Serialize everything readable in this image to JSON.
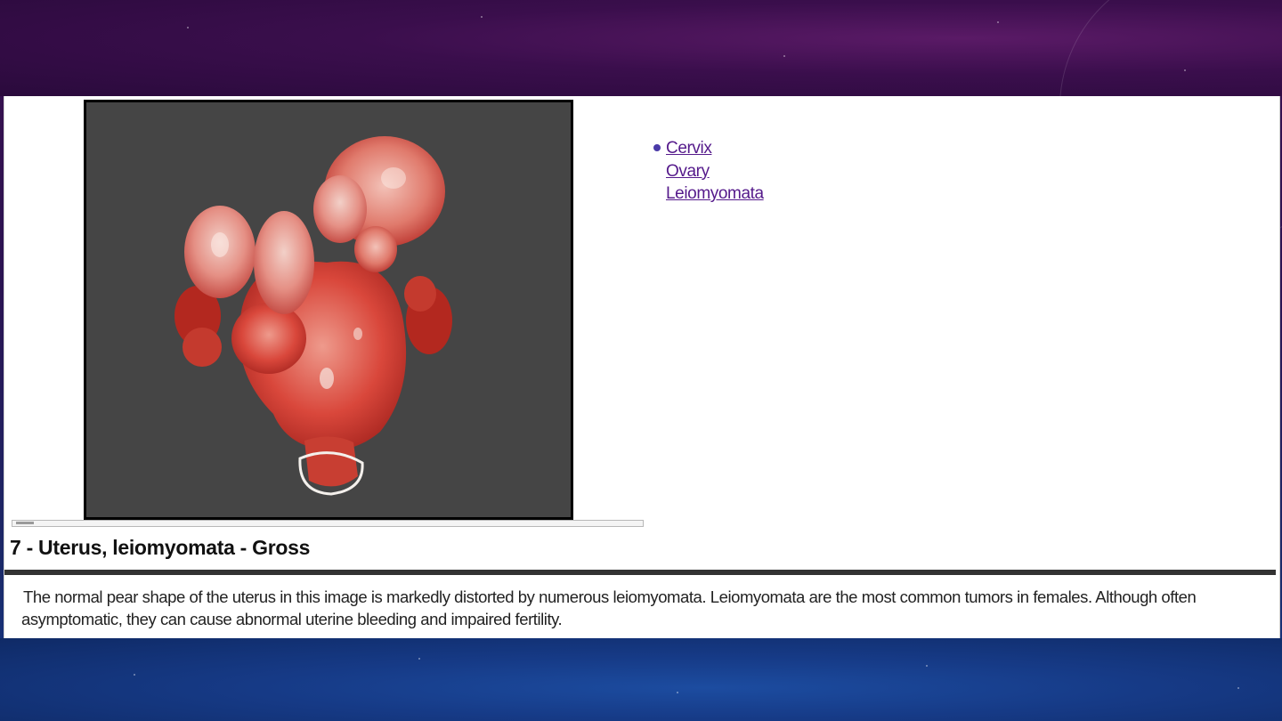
{
  "links": [
    {
      "label": "Cervix"
    },
    {
      "label": "Ovary"
    },
    {
      "label": "Leiomyomata"
    }
  ],
  "figure": {
    "title": "7 - Uterus, leiomyomata - Gross",
    "description": "The normal pear shape of the uterus in this image is markedly distorted by numerous leiomyomata. Leiomyomata are the most common tumors in females. Although often asymptomatic, they can cause abnormal uterine bleeding and impaired fertility."
  },
  "colors": {
    "link": "#551a8b",
    "bullet": "#4a3aa8",
    "photo_background": "#454545",
    "tissue": "#d8453a"
  }
}
